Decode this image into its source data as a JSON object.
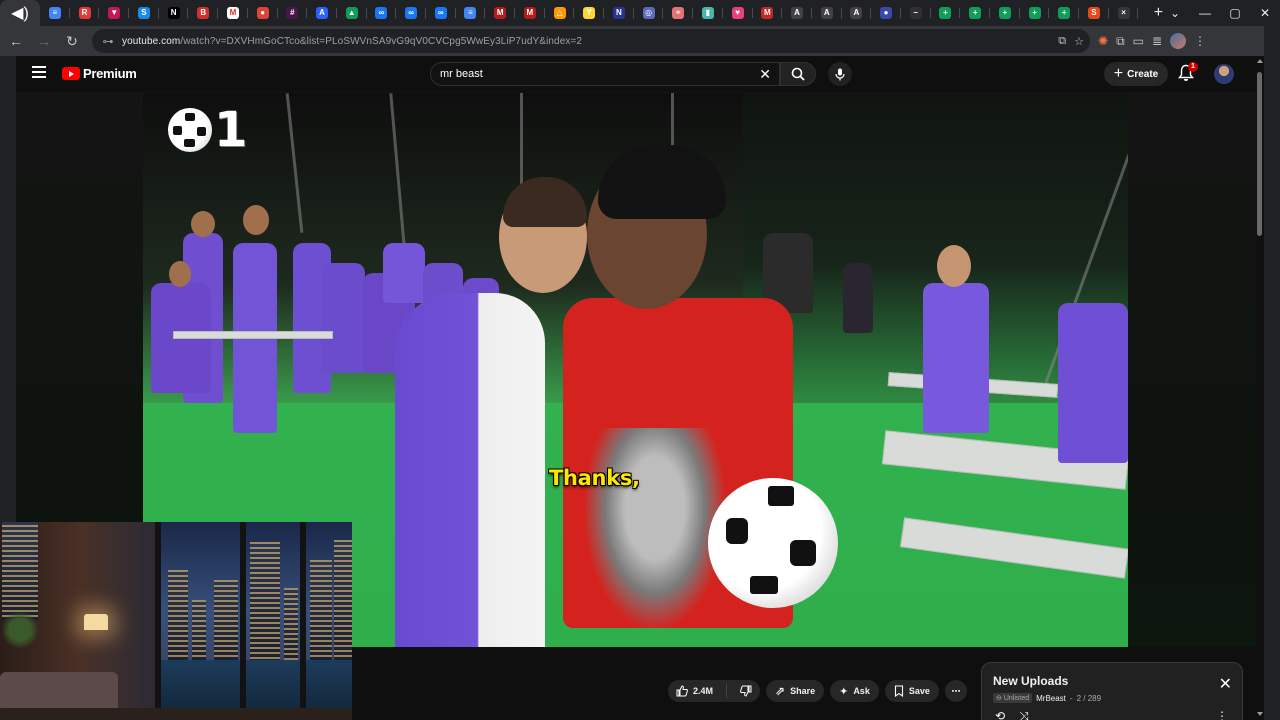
{
  "browser": {
    "tabs": [
      {
        "icon": "speaker-icon",
        "color": "#35363a",
        "glyph": "◀)"
      },
      {
        "icon": "docs-icon",
        "color": "#4285f4",
        "glyph": "≡"
      },
      {
        "icon": "r-icon",
        "color": "#e53935",
        "glyph": "R"
      },
      {
        "icon": "chevron-icon",
        "color": "#c2185b",
        "glyph": "▼"
      },
      {
        "icon": "s-icon",
        "color": "#1e88e5",
        "glyph": "S"
      },
      {
        "icon": "notion-icon",
        "color": "#000000",
        "glyph": "N"
      },
      {
        "icon": "b-icon",
        "color": "#d32f2f",
        "glyph": "B"
      },
      {
        "icon": "gmail-icon",
        "color": "#ffffff",
        "glyph": "M"
      },
      {
        "icon": "chrome-icon",
        "color": "#db4437",
        "glyph": "●"
      },
      {
        "icon": "slack-icon",
        "color": "#4a154b",
        "glyph": "#"
      },
      {
        "icon": "a-icon",
        "color": "#2962ff",
        "glyph": "A"
      },
      {
        "icon": "drive-icon",
        "color": "#0f9d58",
        "glyph": "▲"
      },
      {
        "icon": "meta-icon",
        "color": "#1877f2",
        "glyph": "∞"
      },
      {
        "icon": "meta-icon",
        "color": "#1877f2",
        "glyph": "∞"
      },
      {
        "icon": "meta-icon",
        "color": "#1877f2",
        "glyph": "∞"
      },
      {
        "icon": "docs-icon",
        "color": "#4285f4",
        "glyph": "≡"
      },
      {
        "icon": "m-icon",
        "color": "#b71c1c",
        "glyph": "M"
      },
      {
        "icon": "m-icon",
        "color": "#b71c1c",
        "glyph": "M"
      },
      {
        "icon": "triangle-icon",
        "color": "#ff9800",
        "glyph": "△"
      },
      {
        "icon": "y-icon",
        "color": "#fdd835",
        "glyph": "Y"
      },
      {
        "icon": "n-icon",
        "color": "#283593",
        "glyph": "N"
      },
      {
        "icon": "globe-icon",
        "color": "#5c6bc0",
        "glyph": "◎"
      },
      {
        "icon": "link-icon",
        "color": "#e57373",
        "glyph": "⚭"
      },
      {
        "icon": "book-icon",
        "color": "#4db6ac",
        "glyph": "▮"
      },
      {
        "icon": "heart-icon",
        "color": "#ec407a",
        "glyph": "♥"
      },
      {
        "icon": "m-icon",
        "color": "#c62828",
        "glyph": "M"
      },
      {
        "icon": "ace-icon",
        "color": "#424242",
        "glyph": "A"
      },
      {
        "icon": "ace-icon",
        "color": "#424242",
        "glyph": "A"
      },
      {
        "icon": "ace-icon",
        "color": "#424242",
        "glyph": "A"
      },
      {
        "icon": "circle-icon",
        "color": "#3949ab",
        "glyph": "●"
      },
      {
        "icon": "dash-icon",
        "color": "#303030",
        "glyph": "–"
      },
      {
        "icon": "sheets-icon",
        "color": "#0f9d58",
        "glyph": "+"
      },
      {
        "icon": "sheets-icon",
        "color": "#0f9d58",
        "glyph": "+"
      },
      {
        "icon": "sheets-icon",
        "color": "#0f9d58",
        "glyph": "+"
      },
      {
        "icon": "sheets-icon",
        "color": "#0f9d58",
        "glyph": "+"
      },
      {
        "icon": "sheets-icon",
        "color": "#0f9d58",
        "glyph": "+"
      },
      {
        "icon": "s-icon",
        "color": "#e64a19",
        "glyph": "S"
      },
      {
        "icon": "close-icon",
        "color": "#35363a",
        "glyph": "×"
      }
    ],
    "new_tab": "+",
    "url_domain": "youtube.com",
    "url_path": "/watch?v=DXVHmGoCTco&list=PLoSWVnSA9vG9qV0CVCpg5WwEy3LiP7udY&index=2"
  },
  "youtube": {
    "logo_text": "Premium",
    "search_value": "mr beast",
    "create_label": "Create",
    "notification_count": "1"
  },
  "video": {
    "score_number": "1",
    "caption": "Thanks,"
  },
  "actions": {
    "likes": "2.4M",
    "share": "Share",
    "ask": "Ask",
    "save": "Save"
  },
  "playlist": {
    "title": "New Uploads",
    "visibility": "Unlisted",
    "owner": "MrBeast",
    "position": "2 / 289"
  },
  "colors": {
    "yt_red": "#ff0000",
    "caption_yellow": "#ffe600",
    "jersey_red": "#d4231e",
    "green_screen": "#32b14f",
    "purple_team": "#6f4fd0"
  }
}
